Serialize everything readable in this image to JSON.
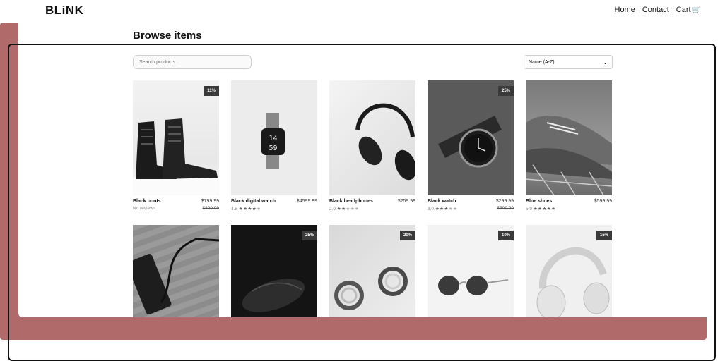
{
  "brand": {
    "name": "BLiNK"
  },
  "nav": {
    "home": "Home",
    "contact": "Contact",
    "cart": "Cart"
  },
  "page": {
    "title": "Browse items"
  },
  "search": {
    "placeholder": "Search products..."
  },
  "sort": {
    "selected": "Name (A-Z)"
  },
  "products": [
    {
      "name": "Black boots",
      "price": "$799.99",
      "old_price": "$899.99",
      "rating_text": "No reviews",
      "stars": 0,
      "badge": "11%",
      "theme": "boots"
    },
    {
      "name": "Black digital watch",
      "price": "$4599.99",
      "old_price": "",
      "rating_text": "4.5",
      "stars": 4.5,
      "badge": "",
      "theme": "digital-watch"
    },
    {
      "name": "Black headphones",
      "price": "$259.99",
      "old_price": "",
      "rating_text": "2.0",
      "stars": 2,
      "badge": "",
      "theme": "headphones-black"
    },
    {
      "name": "Black watch",
      "price": "$299.99",
      "old_price": "$399.99",
      "rating_text": "3.0",
      "stars": 3,
      "badge": "25%",
      "theme": "watch"
    },
    {
      "name": "Blue shoes",
      "price": "$599.99",
      "old_price": "",
      "rating_text": "5.0",
      "stars": 5,
      "badge": "",
      "theme": "shoes"
    },
    {
      "name": "",
      "price": "",
      "old_price": "",
      "rating_text": "",
      "stars": 0,
      "badge": "",
      "theme": "powerbank"
    },
    {
      "name": "",
      "price": "",
      "old_price": "",
      "rating_text": "",
      "stars": 0,
      "badge": "25%",
      "theme": "mouse"
    },
    {
      "name": "",
      "price": "",
      "old_price": "",
      "rating_text": "",
      "stars": 0,
      "badge": "20%",
      "theme": "earrings"
    },
    {
      "name": "",
      "price": "",
      "old_price": "",
      "rating_text": "",
      "stars": 0,
      "badge": "10%",
      "theme": "sunglasses"
    },
    {
      "name": "",
      "price": "",
      "old_price": "",
      "rating_text": "",
      "stars": 0,
      "badge": "15%",
      "theme": "headphones-white"
    }
  ]
}
